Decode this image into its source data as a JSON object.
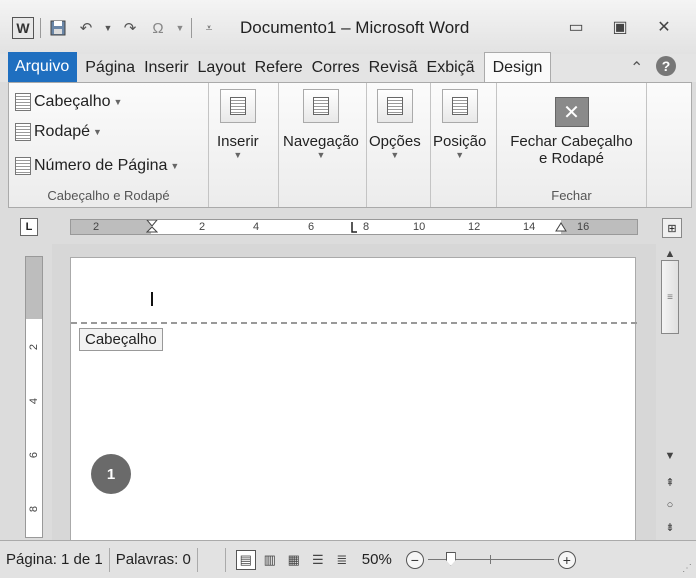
{
  "window": {
    "title": "Documento1 – Microsoft Word",
    "app_icon": "W"
  },
  "quick_access": {
    "save": "save-icon",
    "undo": "undo-icon",
    "redo": "redo-icon",
    "symbol": "Ω"
  },
  "tabs": [
    {
      "label": "Arquivo"
    },
    {
      "label": "Página"
    },
    {
      "label": "Inserir"
    },
    {
      "label": "Layout"
    },
    {
      "label": "Refere"
    },
    {
      "label": "Corres"
    },
    {
      "label": "Revisã"
    },
    {
      "label": "Exbiçã"
    },
    {
      "label": "Design"
    }
  ],
  "ribbon": {
    "header_footer_group": {
      "label": "Cabeçalho e Rodapé",
      "header": "Cabeçalho",
      "footer": "Rodapé",
      "page_number": "Número de Página"
    },
    "insert": "Inserir",
    "navigation": "Navegação",
    "options": "Opções",
    "position": "Posição",
    "close_group": {
      "label": "Fechar",
      "button_line1": "Fechar Cabeçalho",
      "button_line2": "e Rodapé"
    }
  },
  "ruler": {
    "h_numbers": [
      "2",
      "2",
      "4",
      "6",
      "8",
      "10",
      "12",
      "14",
      "16"
    ],
    "v_numbers": [
      "2",
      "4",
      "6",
      "8"
    ]
  },
  "document": {
    "header_label": "Cabeçalho",
    "callout_number": "1"
  },
  "status": {
    "page": "Página: 1 de 1",
    "words": "Palavras: 0",
    "zoom": "50%",
    "zoom_fraction": 0.5
  },
  "colors": {
    "file_tab": "#1f6fc0",
    "callout": "#6a6a6a"
  }
}
